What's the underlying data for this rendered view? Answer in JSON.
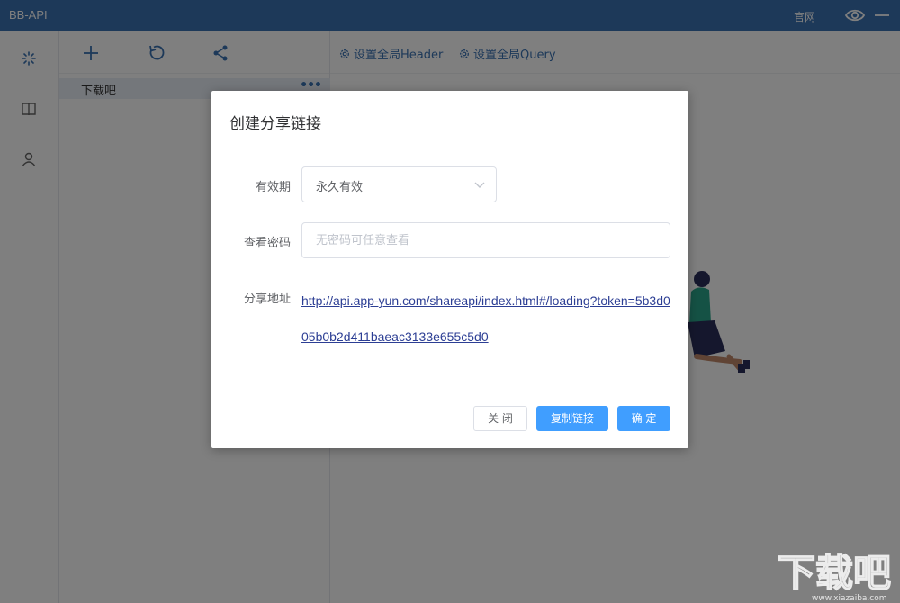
{
  "app": {
    "title": "BB-API",
    "site_link": "官网"
  },
  "icons": {
    "eye": "eye-icon",
    "minimize": "minimize-icon",
    "rail": [
      "api-icon",
      "book-icon",
      "user-icon"
    ],
    "toolbar": [
      "add-icon",
      "refresh-icon",
      "share-icon"
    ]
  },
  "sidebar": {
    "project_name": "下载吧",
    "more": "•••"
  },
  "main": {
    "global_header_label": "设置全局Header",
    "global_query_label": "设置全局Query"
  },
  "dialog": {
    "title": "创建分享链接",
    "validity_label": "有效期",
    "validity_value": "永久有效",
    "password_label": "查看密码",
    "password_placeholder": "无密码可任意查看",
    "password_value": "",
    "share_label": "分享地址",
    "share_url": "http://api.app-yun.com/shareapi/index.html#/loading?token=5b3d005b0b2d411baeac3133e655c5d0",
    "close_button": "关 闭",
    "copy_button": "复制链接",
    "ok_button": "确 定"
  },
  "watermark": {
    "text": "下载吧",
    "url": "www.xiazaiba.com"
  },
  "colors": {
    "topbar": "#3a72b3",
    "primary": "#409eff",
    "link": "#2c3e94"
  }
}
